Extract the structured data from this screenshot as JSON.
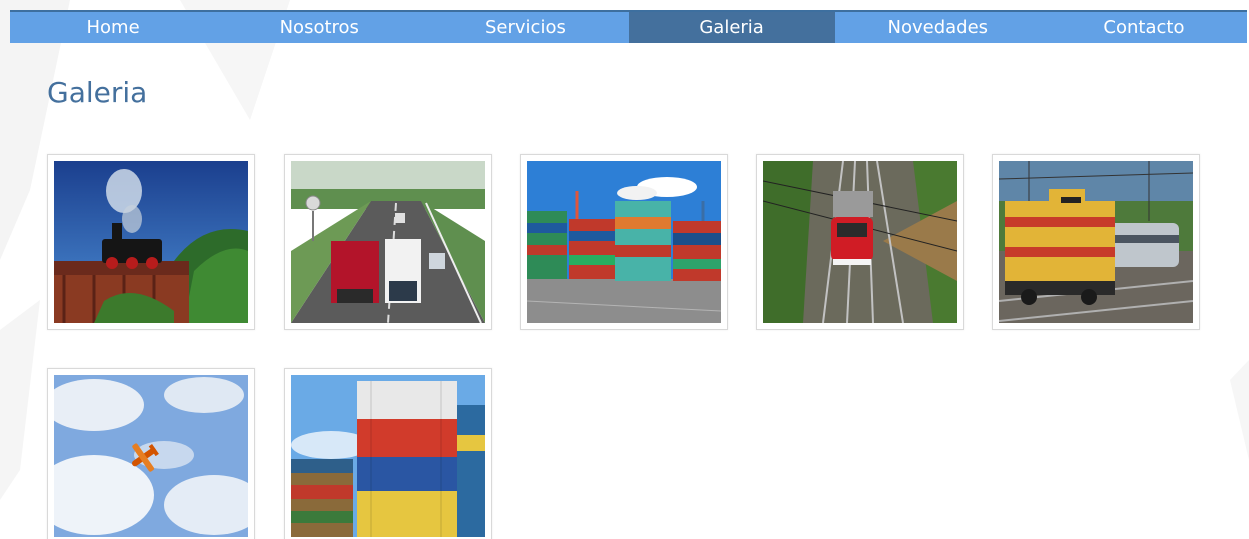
{
  "nav": {
    "items": [
      {
        "label": "Home",
        "active": false
      },
      {
        "label": "Nosotros",
        "active": false
      },
      {
        "label": "Servicios",
        "active": false
      },
      {
        "label": "Galeria",
        "active": true
      },
      {
        "label": "Novedades",
        "active": false
      },
      {
        "label": "Contacto",
        "active": false
      }
    ]
  },
  "page": {
    "title": "Galeria"
  },
  "gallery": {
    "images": [
      {
        "icon": "steam-train-on-bridge-image"
      },
      {
        "icon": "trucks-on-highway-image"
      },
      {
        "icon": "container-port-image"
      },
      {
        "icon": "red-train-on-rails-image"
      },
      {
        "icon": "yellow-locomotive-image"
      },
      {
        "icon": "airplane-in-sky-image"
      },
      {
        "icon": "stacked-containers-image"
      }
    ]
  },
  "colors": {
    "nav_bg": "#62a1e6",
    "nav_active": "#44709d",
    "title": "#44709d"
  }
}
